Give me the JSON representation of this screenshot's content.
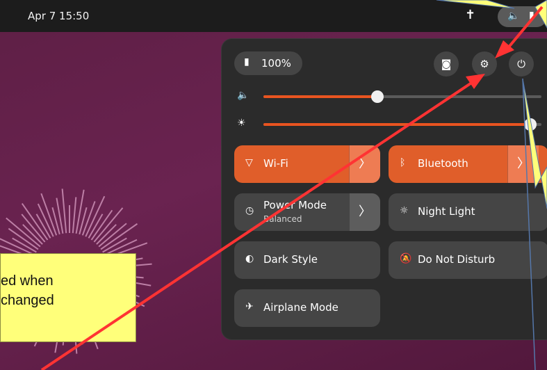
{
  "topbar": {
    "datetime": "Apr 7  15:50",
    "accessibility_icon": "accessibility-icon",
    "volume_icon": "volume-icon",
    "battery_icon": "battery-charging-icon"
  },
  "quick_settings": {
    "battery": {
      "label": "100%",
      "icon": "battery-charging-icon"
    },
    "header_buttons": [
      {
        "name": "screenshot",
        "icon": "camera-icon"
      },
      {
        "name": "settings",
        "icon": "gear-icon"
      },
      {
        "name": "power",
        "icon": "power-icon"
      }
    ],
    "volume_level": 0.41,
    "brightness_level": 0.96,
    "tiles": {
      "wifi": {
        "label": "Wi-Fi",
        "icon": "wifi-icon",
        "arrow": "〉"
      },
      "bluetooth": {
        "label": "Bluetooth",
        "icon": "bluetooth-icon",
        "arrow": "〉"
      },
      "power_mode": {
        "label": "Power Mode",
        "sub": "Balanced",
        "icon": "power-mode-icon",
        "arrow": "〉"
      },
      "night_light": {
        "label": "Night Light",
        "icon": "night-light-icon"
      },
      "dark_style": {
        "label": "Dark Style",
        "icon": "dark-style-icon"
      },
      "dnd": {
        "label": "Do Not Disturb",
        "icon": "bell-muted-icon"
      },
      "airplane": {
        "label": "Airplane Mode",
        "icon": "airplane-icon"
      }
    }
  },
  "annotation": {
    "line1": "ed when",
    "line2": "changed",
    "box_color": "#ffff7a",
    "arrow_color": "#ff3333"
  },
  "colors": {
    "accent": "#e95420",
    "panel": "#2b2b2b"
  }
}
